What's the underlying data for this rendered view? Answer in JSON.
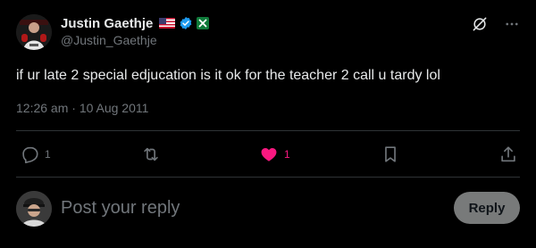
{
  "author": {
    "display_name": "Justin Gaethje",
    "handle": "@Justin_Gaethje",
    "avatar_icon": "fighter-avatar-icon",
    "badges": [
      "us-flag-icon",
      "verified-badge-icon",
      "x-badge-icon"
    ]
  },
  "header_icons": [
    "grok-icon",
    "more-icon"
  ],
  "tweet": {
    "text": "if ur late 2 special edjucation is it ok for the teacher 2 call u tardy lol",
    "timestamp": "12:26 am · 10 Aug 2011"
  },
  "actions": {
    "reply_count": "1",
    "retweet_count": "",
    "like_count": "1",
    "liked": true
  },
  "reply": {
    "placeholder": "Post your reply",
    "button_label": "Reply"
  },
  "colors": {
    "background": "#000000",
    "text": "#e7e9ea",
    "muted": "#71767b",
    "like_pink": "#f91880",
    "verified_blue": "#1d9bf0",
    "divider": "#2f3336",
    "reply_button_bg": "#787a7a"
  }
}
